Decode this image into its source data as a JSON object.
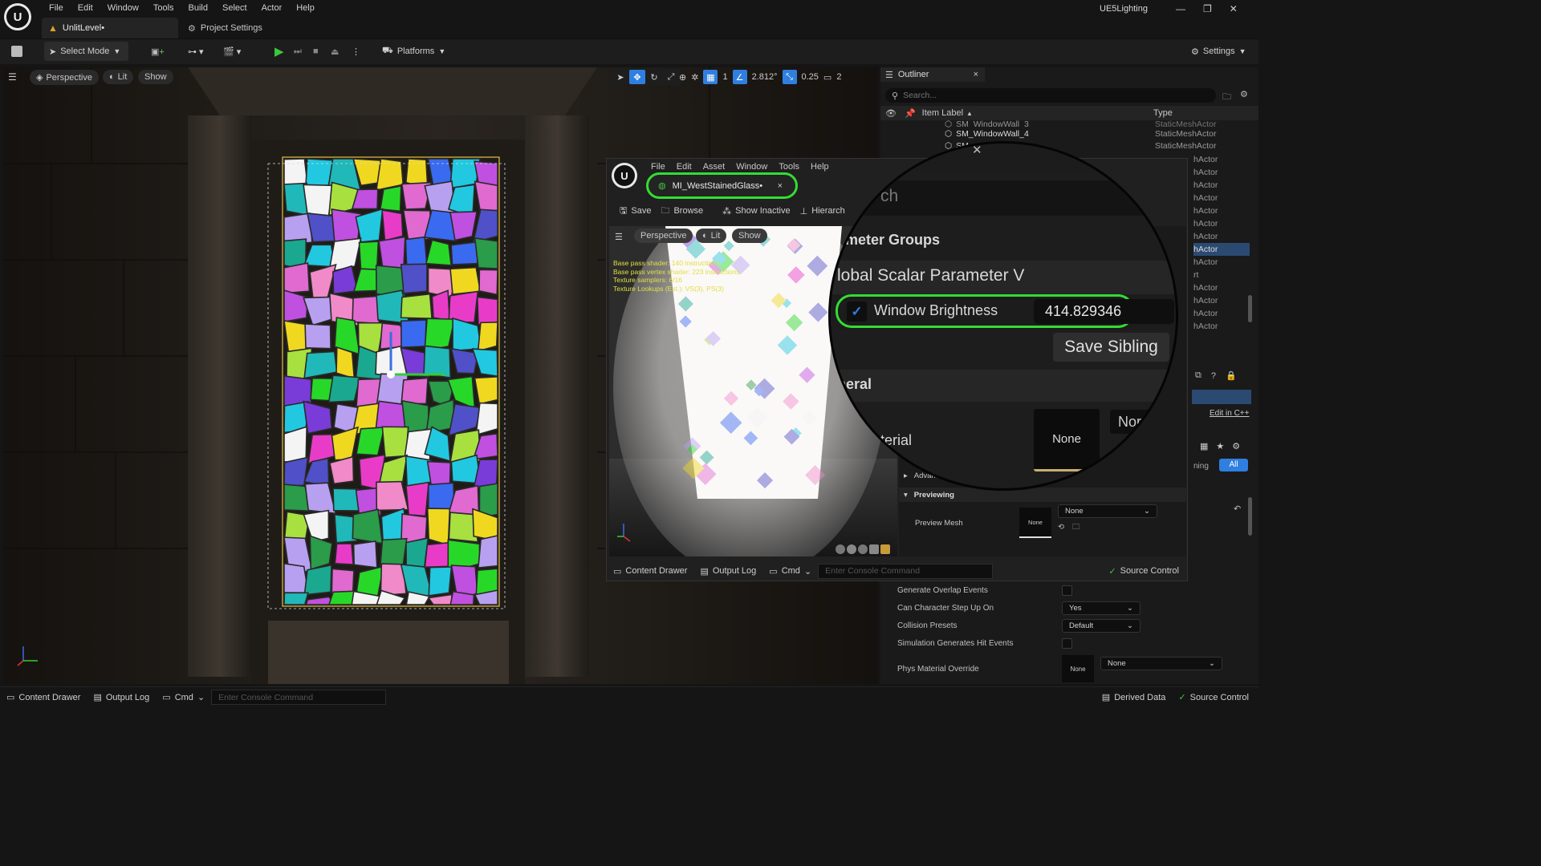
{
  "app": {
    "project": "UE5Lighting",
    "tabs": [
      {
        "label": "UnlitLevel•"
      },
      {
        "label": "Project Settings"
      }
    ]
  },
  "menu": [
    "File",
    "Edit",
    "Window",
    "Tools",
    "Build",
    "Select",
    "Actor",
    "Help"
  ],
  "toolbar": {
    "select_mode": "Select Mode",
    "platforms": "Platforms",
    "settings": "Settings"
  },
  "viewport": {
    "perspective": "Perspective",
    "lit": "Lit",
    "show": "Show",
    "angle_snap": "2.812°",
    "scale_snap": "0.25",
    "grid_snap": "1",
    "camera_speed": "2"
  },
  "outliner": {
    "title": "Outliner",
    "search_placeholder": "Search...",
    "col_label": "Item Label",
    "col_type": "Type",
    "rows": [
      {
        "label": "SM_WindowWall_3",
        "type": "StaticMeshActor"
      },
      {
        "label": "SM_WindowWall_4",
        "type": "StaticMeshActor"
      },
      {
        "label": "SM_WindowWall_5",
        "type": "StaticMeshActor"
      }
    ],
    "type_fragments": [
      "hActor",
      "hActor",
      "hActor",
      "hActor",
      "hActor",
      "hActor",
      "hActor",
      "hActor",
      "hActor",
      "rt",
      "hActor",
      "hActor",
      "hActor",
      "hActor"
    ]
  },
  "details": {
    "edit_cpp": "Edit in C++",
    "filter_all": "All",
    "filter_partial": "ning",
    "rows": [
      {
        "label": "Generate Overlap Events",
        "kind": "check"
      },
      {
        "label": "Can Character Step Up On",
        "kind": "drop",
        "value": "Yes"
      },
      {
        "label": "Collision Presets",
        "kind": "drop",
        "value": "Default"
      },
      {
        "label": "Simulation Generates Hit Events",
        "kind": "check"
      },
      {
        "label": "Phys Material Override",
        "kind": "asset",
        "value": "None"
      }
    ]
  },
  "material_editor": {
    "tab": "MI_WestStainedGlass•",
    "menu": [
      "File",
      "Edit",
      "Asset",
      "Window",
      "Tools",
      "Help"
    ],
    "toolbar": {
      "save": "Save",
      "browse": "Browse",
      "show_inactive": "Show Inactive",
      "hierarchy": "Hierarch"
    },
    "viewport": {
      "perspective": "Perspective",
      "lit": "Lit",
      "show": "Show"
    },
    "stats": [
      "Base pass shader: 140 instructions",
      "Base pass vertex shader: 223 instructions",
      "Texture samplers: 6/16",
      "Texture Lookups (Est.): VS(3), PS(3)"
    ],
    "advanced": "Advanced",
    "previewing": "Previewing",
    "preview_mesh_label": "Preview Mesh",
    "preview_mesh_value": "None",
    "preview_thumb": "None",
    "footer": {
      "content_drawer": "Content Drawer",
      "output_log": "Output Log",
      "cmd": "Cmd",
      "console_placeholder": "Enter Console Command",
      "source_control": "Source Control"
    }
  },
  "magnifier": {
    "search_fragment": "ch",
    "parameter_groups": "ameter Groups",
    "scalar_group": "lobal Scalar Parameter V",
    "param_name": "Window Brightness",
    "param_value": "414.829346",
    "save_sibling": "Save Sibling",
    "general": "neral",
    "material": "aterial",
    "material_thumb": "None",
    "none_partial": "Nor"
  },
  "statusbar": {
    "content_drawer": "Content Drawer",
    "output_log": "Output Log",
    "cmd": "Cmd",
    "console_placeholder": "Enter Console Command",
    "derived_data": "Derived Data",
    "source_control": "Source Control"
  },
  "colors": {
    "highlight": "#33dd33",
    "accent": "#2f7fe0",
    "selection": "#2b4a72"
  }
}
